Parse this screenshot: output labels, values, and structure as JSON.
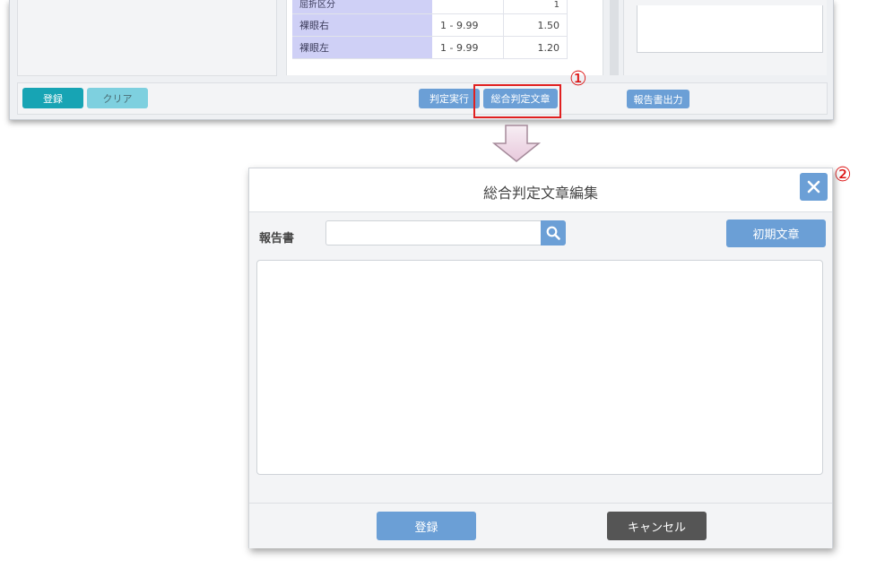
{
  "top_screen": {
    "table_rows": [
      {
        "label": "屈折区分",
        "range": "",
        "value": "1"
      },
      {
        "label": "裸眼右",
        "range": "1 - 9.99",
        "value": "1.50"
      },
      {
        "label": "裸眼左",
        "range": "1 - 9.99",
        "value": "1.20"
      }
    ],
    "footer": {
      "register_label": "登録",
      "clear_label": "クリア",
      "judge_run_label": "判定実行",
      "overall_judgment_label": "総合判定文章",
      "report_output_label": "報告書出力"
    }
  },
  "annotations": {
    "marker_1": "①",
    "marker_2": "②",
    "highlight_color": "#e02020"
  },
  "dialog": {
    "title": "総合判定文章編集",
    "close_icon": "close-icon",
    "report_label": "報告書",
    "search_value": "",
    "search_icon": "search-icon",
    "initial_text_button": "初期文章",
    "textarea_value": "",
    "register_button": "登録",
    "cancel_button": "キャンセル"
  },
  "colors": {
    "primary_blue": "#6b9fd6",
    "teal": "#17a4b4",
    "light_teal": "#7ed0df",
    "cancel_gray": "#555555",
    "label_purple": "#cfd0f6"
  }
}
